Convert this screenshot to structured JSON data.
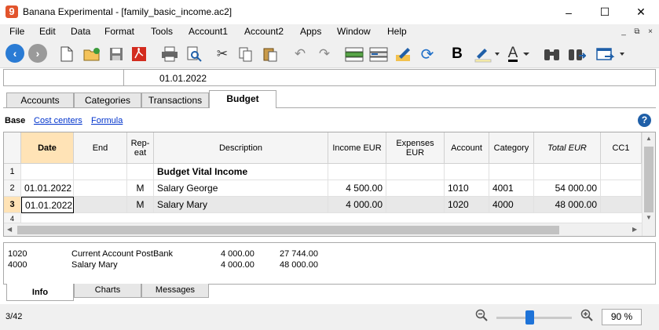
{
  "window": {
    "title": "Banana Experimental - [family_basic_income.ac2]",
    "app_icon_glyph": "9",
    "minimize_glyph": "–",
    "maximize_glyph": "☐",
    "close_glyph": "✕"
  },
  "menu": {
    "items": [
      "File",
      "Edit",
      "Data",
      "Format",
      "Tools",
      "Account1",
      "Account2",
      "Apps",
      "Window",
      "Help"
    ],
    "mdi_controls": [
      "_",
      "⧉",
      "×"
    ]
  },
  "toolbar": {
    "icons": [
      "back-icon",
      "forward-icon",
      "new-file-icon",
      "open-file-icon",
      "save-icon",
      "pdf-icon",
      "print-icon",
      "print-preview-icon",
      "cut-icon",
      "copy-icon",
      "paste-icon",
      "undo-icon",
      "redo-icon",
      "insert-row-icon",
      "delete-row-icon",
      "edit-icon",
      "recheck-icon",
      "bold-icon",
      "highlight-color-icon",
      "text-color-icon",
      "find-icon",
      "replace-icon",
      "window-icon"
    ],
    "bold_label": "B",
    "text_color_label": "A"
  },
  "cell_editor": {
    "address": "",
    "value": "01.01.2022"
  },
  "tabs": [
    "Accounts",
    "Categories",
    "Transactions",
    "Budget"
  ],
  "active_tab": "Budget",
  "views": {
    "active": "Base",
    "links": [
      "Cost centers",
      "Formula"
    ]
  },
  "grid": {
    "columns": [
      "Date",
      "End",
      "Rep-\neat",
      "Description",
      "Income EUR",
      "Expenses EUR",
      "Account",
      "Category",
      "Total EUR",
      "CC1"
    ],
    "rows": [
      {
        "num": "1",
        "date": "",
        "end": "",
        "repeat": "",
        "description": "Budget Vital Income",
        "income": "",
        "expenses": "",
        "account": "",
        "category": "",
        "total": ""
      },
      {
        "num": "2",
        "date": "01.01.2022",
        "end": "",
        "repeat": "M",
        "description": "Salary George",
        "income": "4 500.00",
        "expenses": "",
        "account": "1010",
        "category": "4001",
        "total": "54 000.00"
      },
      {
        "num": "3",
        "date": "01.01.2022",
        "end": "",
        "repeat": "M",
        "description": "Salary Mary",
        "income": "4 000.00",
        "expenses": "",
        "account": "1020",
        "category": "4000",
        "total": "48 000.00"
      },
      {
        "num": "4",
        "date": "",
        "end": "",
        "repeat": "",
        "description": "",
        "income": "",
        "expenses": "",
        "account": "",
        "category": "",
        "total": ""
      }
    ]
  },
  "info": {
    "rows": [
      {
        "account": "1020",
        "description": "Current Account PostBank",
        "amount": "4 000.00",
        "balance": "27 744.00"
      },
      {
        "account": "4000",
        "description": "Salary Mary",
        "amount": "4 000.00",
        "balance": "48 000.00"
      }
    ]
  },
  "bottom_tabs": [
    "Info",
    "Charts",
    "Messages"
  ],
  "status": {
    "position": "3/42",
    "zoom": "90  %",
    "zoom_level_percent": 90
  }
}
